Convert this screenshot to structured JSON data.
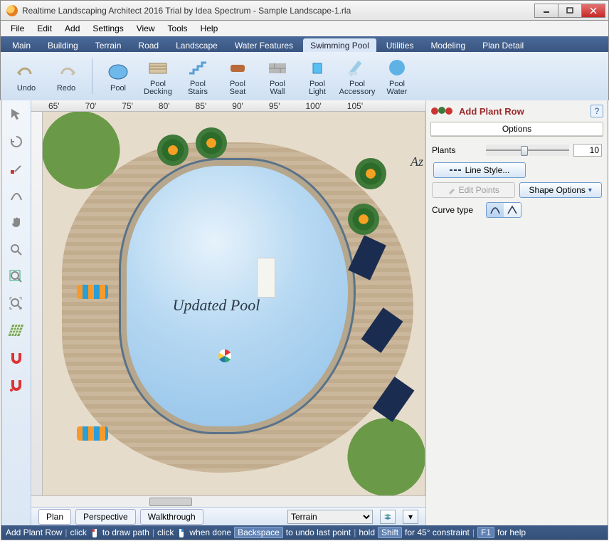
{
  "window": {
    "title": "Realtime Landscaping Architect 2016 Trial by Idea Spectrum - Sample Landscape-1.rla"
  },
  "menu": {
    "items": [
      "File",
      "Edit",
      "Add",
      "Settings",
      "View",
      "Tools",
      "Help"
    ]
  },
  "tabs": {
    "items": [
      "Main",
      "Building",
      "Terrain",
      "Road",
      "Landscape",
      "Water Features",
      "Swimming Pool",
      "Utilities",
      "Modeling",
      "Plan Detail"
    ],
    "active": "Swimming Pool"
  },
  "ribbon": {
    "undo": "Undo",
    "redo": "Redo",
    "items": [
      {
        "label": "Pool"
      },
      {
        "label": "Pool\nDecking"
      },
      {
        "label": "Pool\nStairs"
      },
      {
        "label": "Pool\nSeat"
      },
      {
        "label": "Pool\nWall"
      },
      {
        "label": "Pool\nLight"
      },
      {
        "label": "Pool\nAccessory"
      },
      {
        "label": "Pool\nWater"
      }
    ]
  },
  "ruler": {
    "marks": [
      "65'",
      "70'",
      "75'",
      "80'",
      "85'",
      "90'",
      "95'",
      "100'",
      "105'"
    ]
  },
  "canvas": {
    "pool_label": "Updated Pool",
    "corner_label": "Az"
  },
  "viewtabs": {
    "items": [
      "Plan",
      "Perspective",
      "Walkthrough"
    ],
    "active": "Plan",
    "layer_select": "Terrain"
  },
  "panel": {
    "title": "Add Plant Row",
    "help": "?",
    "options_hdr": "Options",
    "plants_label": "Plants",
    "plants_value": "10",
    "line_style": "Line Style...",
    "edit_points": "Edit Points",
    "shape_options": "Shape Options",
    "curve_type": "Curve type"
  },
  "status": {
    "tool": "Add Plant Row",
    "seg1a": "click",
    "seg1b": "to draw path",
    "seg2a": "click",
    "seg2b": "when done",
    "bksp": "Backspace",
    "bksp_txt": "to undo last point",
    "hold": "hold",
    "shift": "Shift",
    "shift_txt": "for 45° constraint",
    "f1": "F1",
    "f1_txt": "for help"
  }
}
